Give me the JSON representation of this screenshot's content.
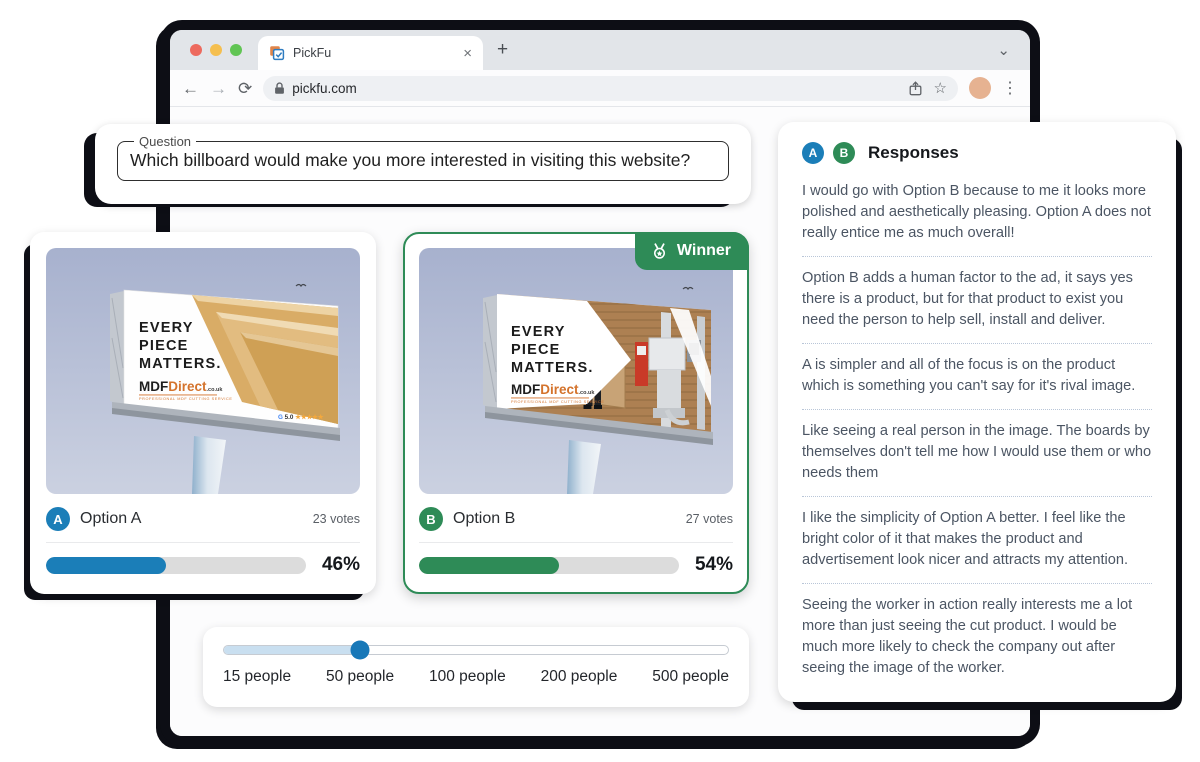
{
  "browser": {
    "tab_title": "PickFu",
    "url": "pickfu.com"
  },
  "icons": {
    "close": "×",
    "new_tab": "+",
    "window_chevron": "⌄",
    "back": "←",
    "forward": "→",
    "reload": "⟳",
    "star": "☆",
    "kebab": "⋮"
  },
  "question": {
    "label": "Question",
    "value": "Which billboard would make you more interested in visiting this website?"
  },
  "poll": {
    "winner_label": "Winner",
    "options": [
      {
        "id": "A",
        "label": "Option A",
        "votes": "23 votes",
        "percent": 46,
        "percent_label": "46%",
        "color": "#1B7EB8"
      },
      {
        "id": "B",
        "label": "Option B",
        "votes": "27 votes",
        "percent": 54,
        "percent_label": "54%",
        "color": "#2E8B57"
      }
    ]
  },
  "billboard": {
    "line1": "EVERY",
    "line2": "PIECE",
    "line3": "MATTERS.",
    "brand_mdf": "MDF",
    "brand_direct": "Direct",
    "brand_tld": ".co.uk",
    "brand_tagline": "PROFESSIONAL MDF CUTTING SERVICE",
    "rating_g": "G",
    "rating_score": " 5.0",
    "rating_stars": " ★★★★★"
  },
  "slider": {
    "labels": [
      "15 people",
      "50 people",
      "100 people",
      "200 people",
      "500 people"
    ],
    "selected": "50 people"
  },
  "responses": {
    "title": "Responses",
    "items": [
      "I would go with Option B because to me it looks more polished and aesthetically pleasing. Option A does not really entice me as much overall!",
      "Option B adds a human factor to the ad, it says yes there is a product, but for that product to exist you need the person to help sell, install and deliver.",
      "A is simpler and all of the focus is on the product which is something you can't say for it's rival image.",
      "Like seeing a real person in the image. The boards by themselves don't tell me how I would use them or who needs them",
      "I like the simplicity of Option A better. I feel like the bright color of it that makes the product and advertisement look nicer and attracts my attention.",
      "Seeing the worker in action really interests me a lot more than just seeing the cut product. I would be much more likely to check the company out after seeing the image of the worker."
    ]
  },
  "colors": {
    "accent_blue": "#1B7EB8",
    "accent_green": "#2E8B57",
    "shadow_black": "#0D0E15",
    "slider_fill": "#C9DFF0"
  }
}
